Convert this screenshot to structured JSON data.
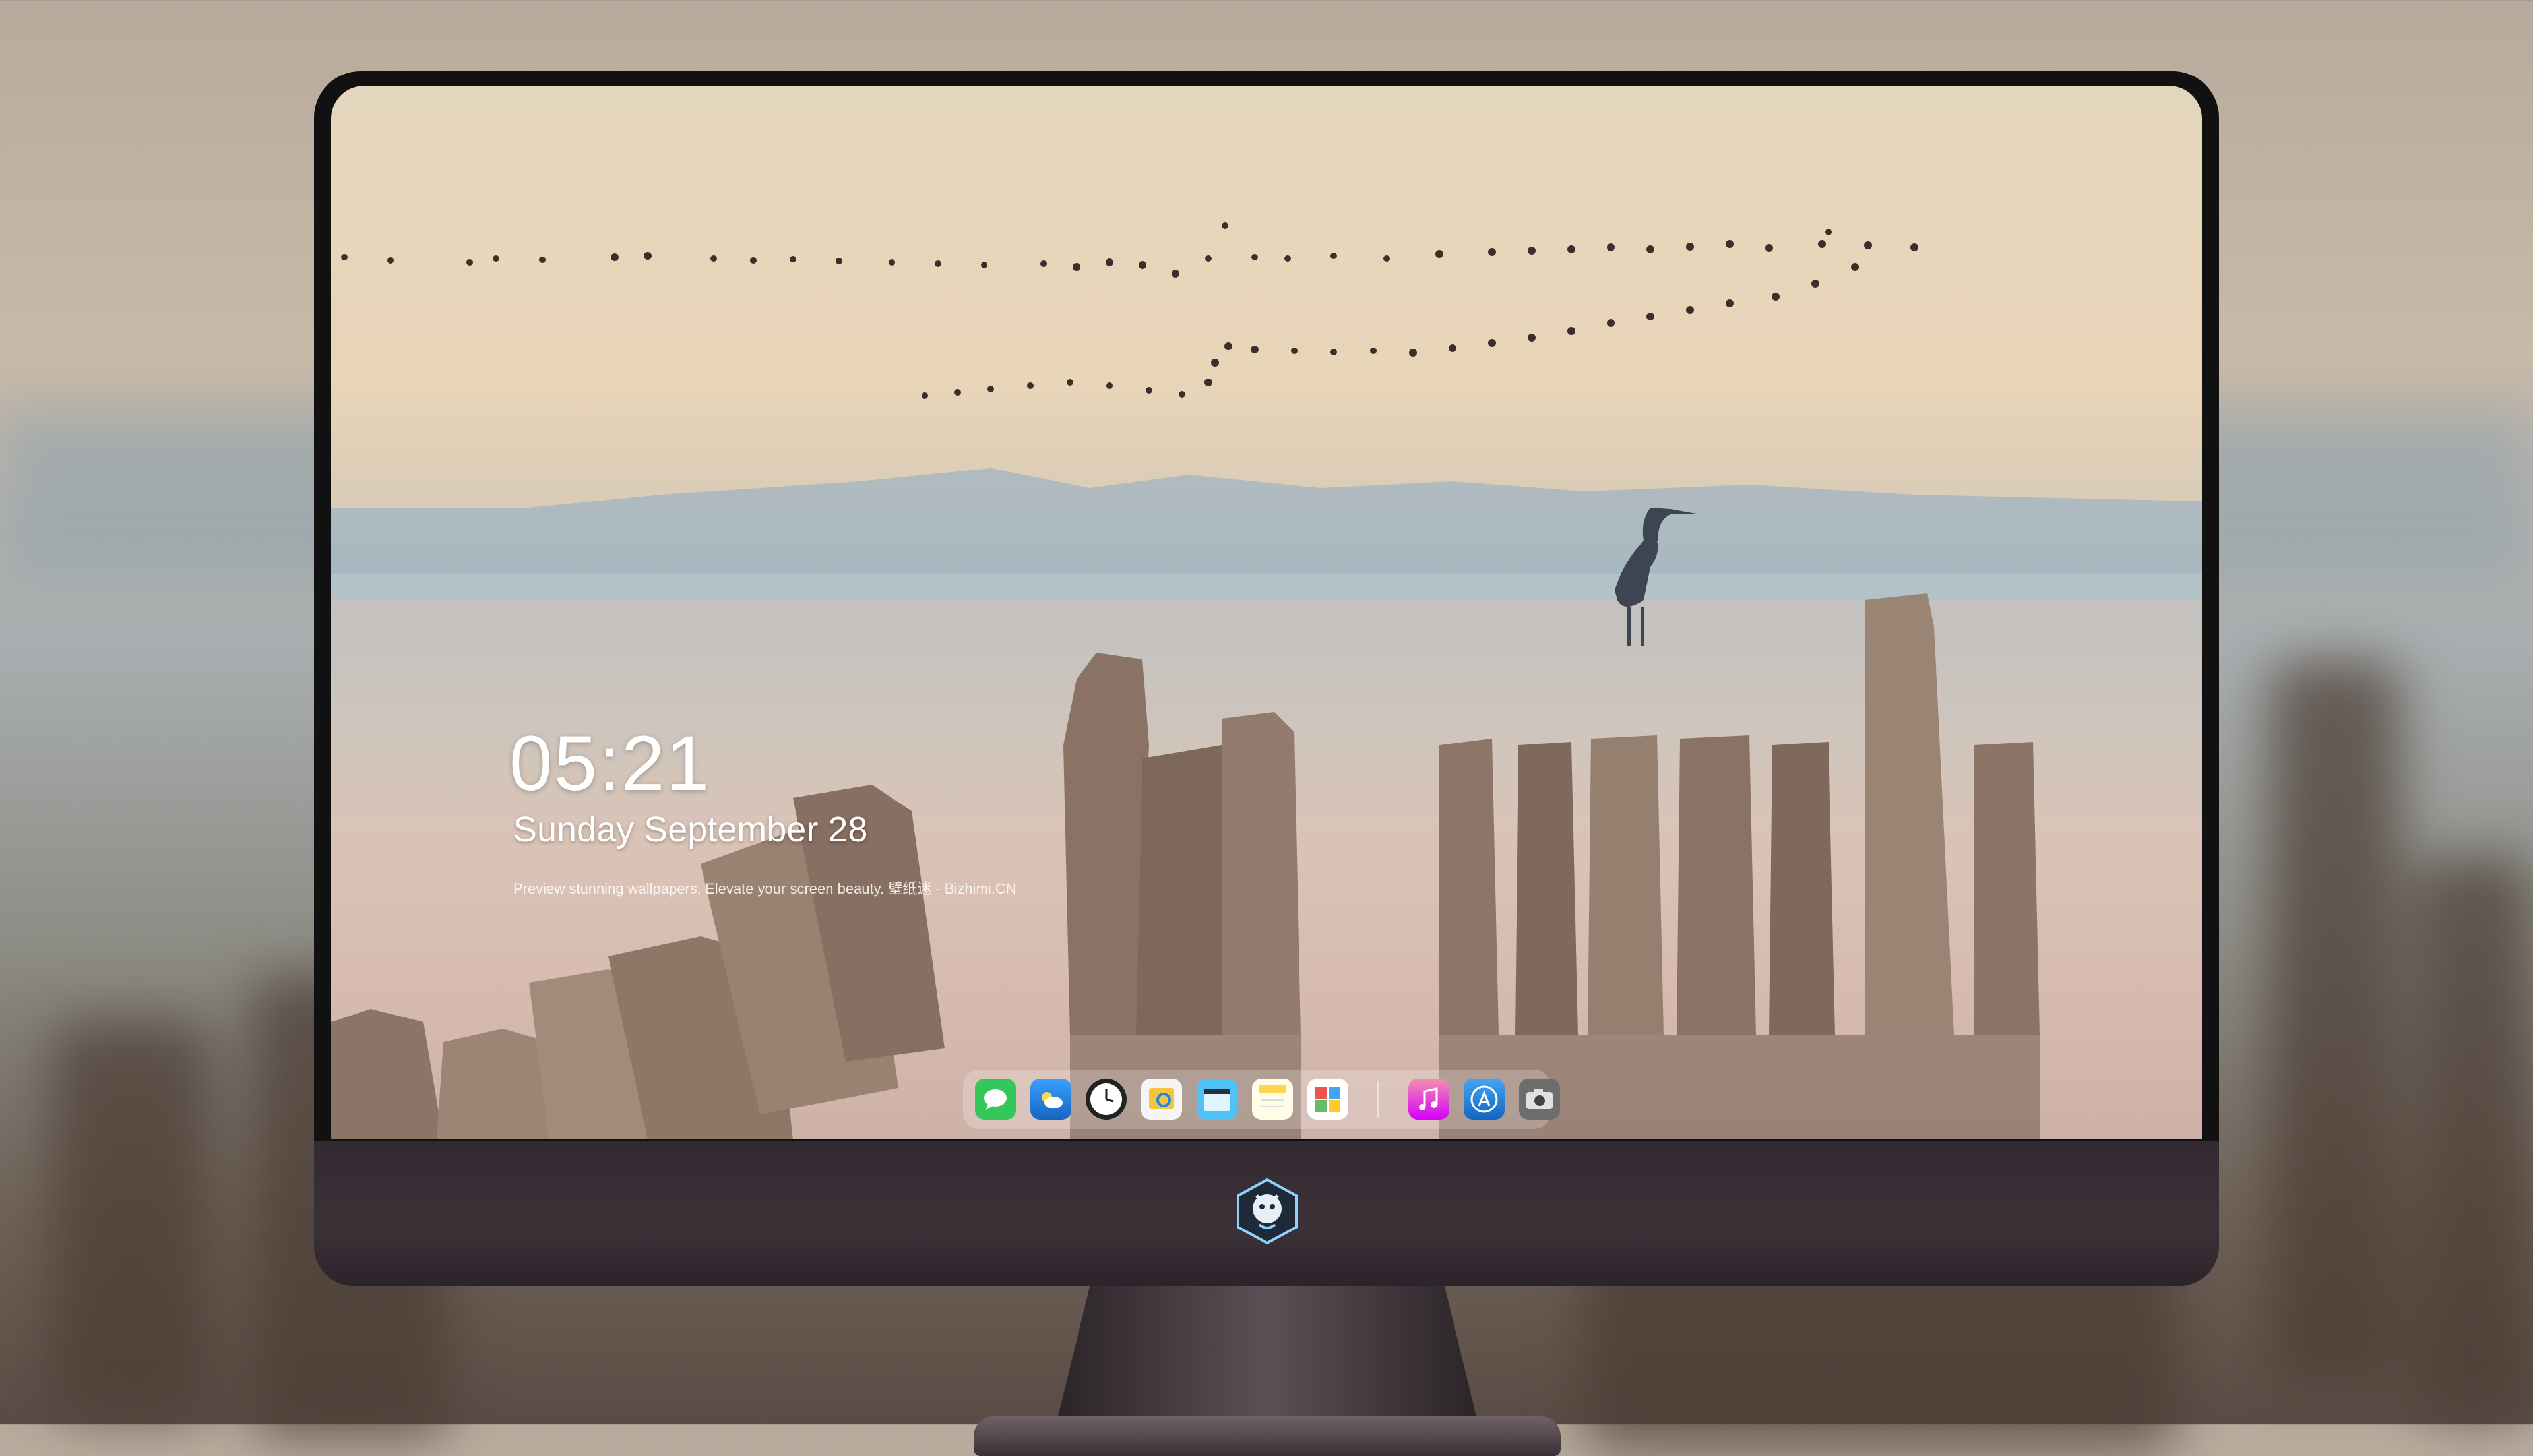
{
  "lockscreen": {
    "time": "05:21",
    "date": "Sunday September  28",
    "tagline": "Preview stunning wallpapers. Elevate your screen beauty. 壁纸迷 - Bizhimi.CN"
  },
  "dock": {
    "items": [
      {
        "name": "messages-icon",
        "color": "#34c759"
      },
      {
        "name": "weather-icon",
        "color": "#1e90ff"
      },
      {
        "name": "clock-icon",
        "color": "#ffffff"
      },
      {
        "name": "preview-icon",
        "color": "#f5c542"
      },
      {
        "name": "clips-icon",
        "color": "#4fc3f7"
      },
      {
        "name": "notes-icon",
        "color": "#ffd54f"
      },
      {
        "name": "photos-grid-icon",
        "color": "#f48fb1"
      },
      {
        "name": "music-icon",
        "color": "#e040fb"
      },
      {
        "name": "app-store-icon",
        "color": "#1e88e5"
      },
      {
        "name": "camera-icon",
        "color": "#6d6d6d"
      }
    ]
  },
  "monitor": {
    "logo": "brand-logo-icon"
  }
}
